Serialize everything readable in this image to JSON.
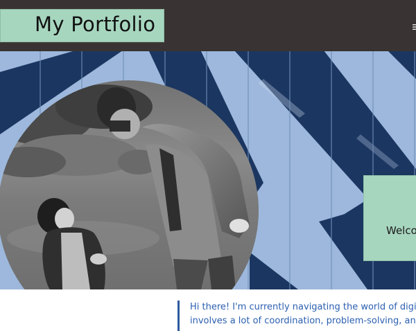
{
  "header": {
    "logo_text": "My Portfolio",
    "background_color": "#393433",
    "logo_bg_color": "#a7d6bf",
    "nav_icon": "hamburger-menu-icon"
  },
  "hero": {
    "photo_alt": "Man and child looking at each other outdoors (black and white photo)",
    "welcome_text": "Welco",
    "stripe_light_color": "#99b5d9",
    "stripe_dark_color": "#1b3660",
    "card_color": "#a7d6bf"
  },
  "intro": {
    "lines": [
      "Hi there! I'm currently navigating the world of digital pro",
      "involves a lot of coordination, problem-solving, and ensu"
    ],
    "text_color": "#2b5fb0",
    "bar_color": "#2d5a9e"
  }
}
